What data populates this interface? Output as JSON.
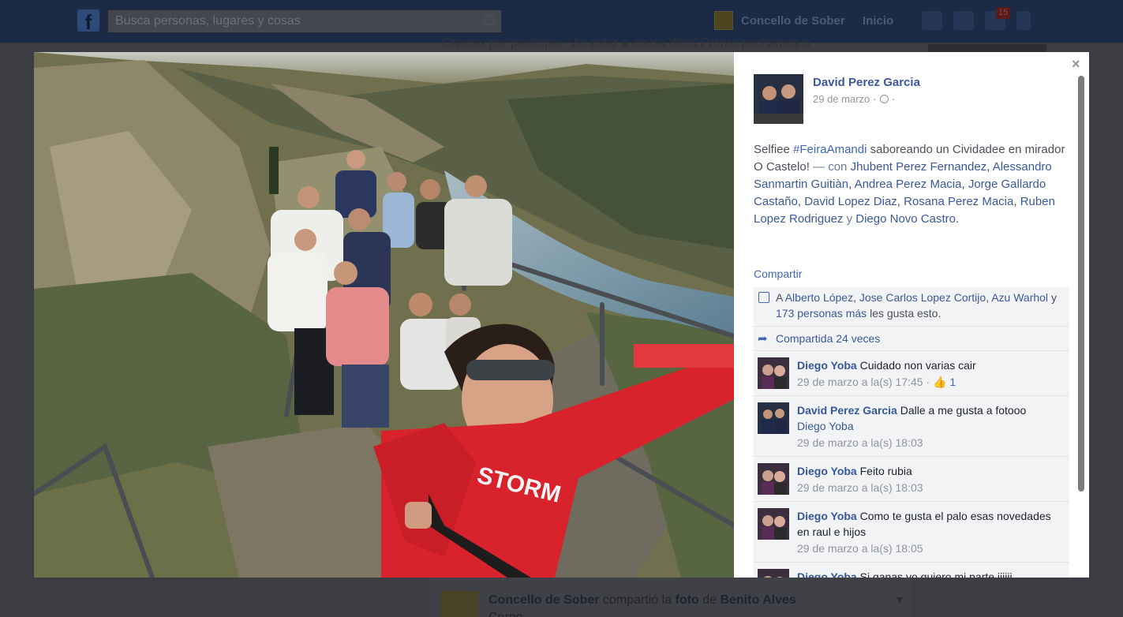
{
  "topbar": {
    "logo": "f",
    "search_placeholder": "Busca personas, lugares y cosas",
    "page_link": "Concello de Sober",
    "home": "Inicio",
    "notifications_badge": "15"
  },
  "background": {
    "status_text": "Gracias por participar. Vai estar a cousa dificil Pronto pechamos o",
    "bottom_post_author": "Concello de Sober",
    "bottom_post_verb": "compartió la",
    "bottom_post_object": "foto",
    "bottom_post_prep": "de",
    "bottom_post_source": "Benito Alves",
    "bottom_post_line2": "Corpo"
  },
  "post": {
    "author": "David Perez Garcia",
    "date": "29 de marzo",
    "caption_text": "Selfiee",
    "hashtag": "#FeiraAmandi",
    "caption_rest": "saboreando un Cividadee en mirador O Castelo!",
    "with_label": "— con",
    "tagged": [
      "Jhubent Perez Fernandez",
      "Alessandro Sanmartin Guitiàn",
      "Andrea Perez Macia",
      "Jorge Gallardo Castaño",
      "David Lopez Diaz",
      "Rosana Perez Macia",
      "Ruben Lopez Rodriguez"
    ],
    "and_word": "y",
    "last_tagged": "Diego Novo Castro",
    "end_period": ".",
    "share_label": "Compartir"
  },
  "ufi": {
    "likes_prefix": "A",
    "likers": [
      "Alberto López",
      "Jose Carlos Lopez Cortijo",
      "Azu Warhol"
    ],
    "likes_and": "y",
    "likes_more": "173 personas más",
    "likes_suffix": "les gusta esto.",
    "shares": "Compartida 24 veces"
  },
  "comments": [
    {
      "author": "Diego Yoba",
      "text": "Cuidado non varias cair",
      "time": "29 de marzo a la(s) 17:45",
      "likes": "1",
      "avatar": "diego"
    },
    {
      "author": "David Perez Garcia",
      "text": "Dalle a me gusta a fotooo",
      "mention": "Diego Yoba",
      "time": "29 de marzo a la(s) 18:03",
      "avatar": "david"
    },
    {
      "author": "Diego Yoba",
      "text": "Feito rubia",
      "time": "29 de marzo a la(s) 18:03",
      "avatar": "diego"
    },
    {
      "author": "Diego Yoba",
      "text": "Como te gusta el palo esas novedades en raul e hijos",
      "time": "29 de marzo a la(s) 18:05",
      "avatar": "diego"
    },
    {
      "author": "Diego Yoba",
      "text": "Si ganas yo quiero mi parte jijiji",
      "avatar": "diego"
    }
  ],
  "icons": {
    "close": "×",
    "globe": "globe-icon",
    "like": "thumbs-up-icon",
    "share": "share-arrow-icon"
  },
  "colors": {
    "link": "#3b5998",
    "shirt_red": "#d8232c",
    "river": "#6d8fa0"
  }
}
